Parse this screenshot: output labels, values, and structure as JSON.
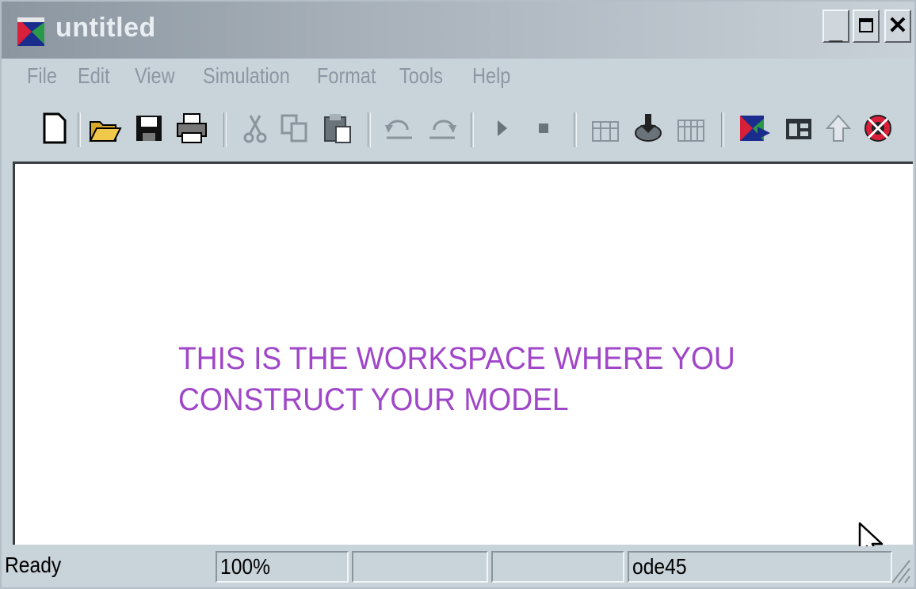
{
  "window": {
    "title": "untitled",
    "controls": [
      "minimize",
      "maximize",
      "close"
    ]
  },
  "menu": [
    {
      "label": "File"
    },
    {
      "label": "Edit"
    },
    {
      "label": "View"
    },
    {
      "label": "Simulation"
    },
    {
      "label": "Format"
    },
    {
      "label": "Tools"
    },
    {
      "label": "Help"
    }
  ],
  "toolbar": {
    "icons": [
      "new-icon",
      "open-icon",
      "save-icon",
      "print-icon",
      "cut-icon",
      "copy-icon",
      "paste-icon",
      "undo-icon",
      "redo-icon",
      "start-simulation-icon",
      "stop-simulation-icon",
      "build-icon",
      "update-diagram-icon",
      "incremental-build-icon",
      "library-browser-icon",
      "model-explorer-icon",
      "go-to-parent-icon",
      "debug-icon"
    ]
  },
  "workspace": {
    "message_line1": "THIS IS THE WORKSPACE WHERE YOU",
    "message_line2": "CONSTRUCT YOUR MODEL",
    "message_color": "#a046c8"
  },
  "status": {
    "state": "Ready",
    "zoom": "100%",
    "field3": "",
    "field4": "",
    "solver": "ode45"
  }
}
